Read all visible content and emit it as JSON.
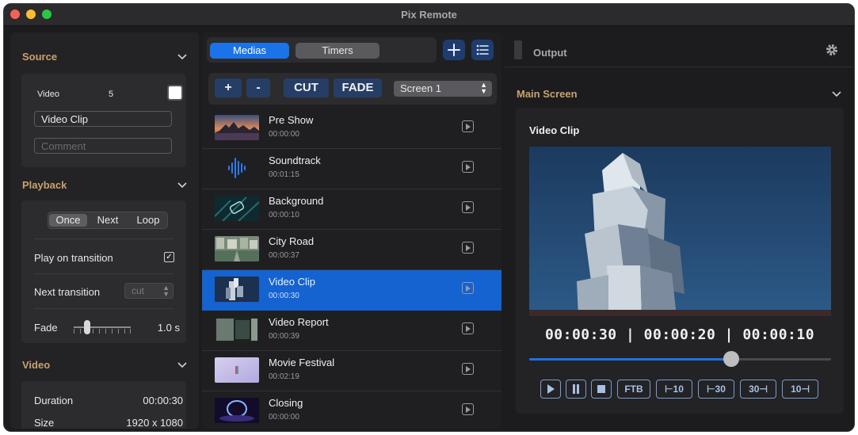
{
  "window": {
    "title": "Pix Remote"
  },
  "source": {
    "title": "Source",
    "video_label": "Video",
    "video_number": "5",
    "name_value": "Video Clip",
    "comment_placeholder": "Comment"
  },
  "playback": {
    "title": "Playback",
    "modes": [
      "Once",
      "Next",
      "Loop"
    ],
    "selected_mode": "Once",
    "play_on_transition_label": "Play on transition",
    "play_on_transition_checked": true,
    "next_transition_label": "Next transition",
    "next_transition_value": "cut",
    "fade_label": "Fade",
    "fade_value": "1.0 s",
    "fade_level": 0.2
  },
  "video": {
    "title": "Video",
    "duration_label": "Duration",
    "duration_value": "00:00:30",
    "size_label": "Size",
    "size_value": "1920 x 1080"
  },
  "tabs": {
    "medias": "Medias",
    "timers": "Timers"
  },
  "toolbar": {
    "plus": "+",
    "minus": "-",
    "cut": "CUT",
    "fade": "FADE",
    "screen": "Screen 1"
  },
  "media_list": [
    {
      "name": "Pre Show",
      "time": "00:00:00",
      "thumb": "sunset"
    },
    {
      "name": "Soundtrack",
      "time": "00:01:15",
      "thumb": "waveform"
    },
    {
      "name": "Background",
      "time": "00:00:10",
      "thumb": "tech"
    },
    {
      "name": "City Road",
      "time": "00:00:37",
      "thumb": "city"
    },
    {
      "name": "Video Clip",
      "time": "00:00:30",
      "thumb": "building",
      "selected": true
    },
    {
      "name": "Video Report",
      "time": "00:00:39",
      "thumb": "room"
    },
    {
      "name": "Movie Festival",
      "time": "00:02:19",
      "thumb": "festival"
    },
    {
      "name": "Closing",
      "time": "00:00:00",
      "thumb": "ring"
    }
  ],
  "output": {
    "title": "Output",
    "main_screen_title": "Main Screen",
    "preview_name": "Video Clip",
    "timecode": "00:00:30 | 00:00:20 | 00:00:10",
    "progress": 0.67,
    "controls": {
      "ftb": "FTB",
      "back10": "10",
      "back30": "30",
      "fwd30": "30",
      "fwd10": "10"
    }
  },
  "colors": {
    "accent": "#1a73e8",
    "section": "#c9a16e",
    "selected_row": "#1562d1"
  }
}
